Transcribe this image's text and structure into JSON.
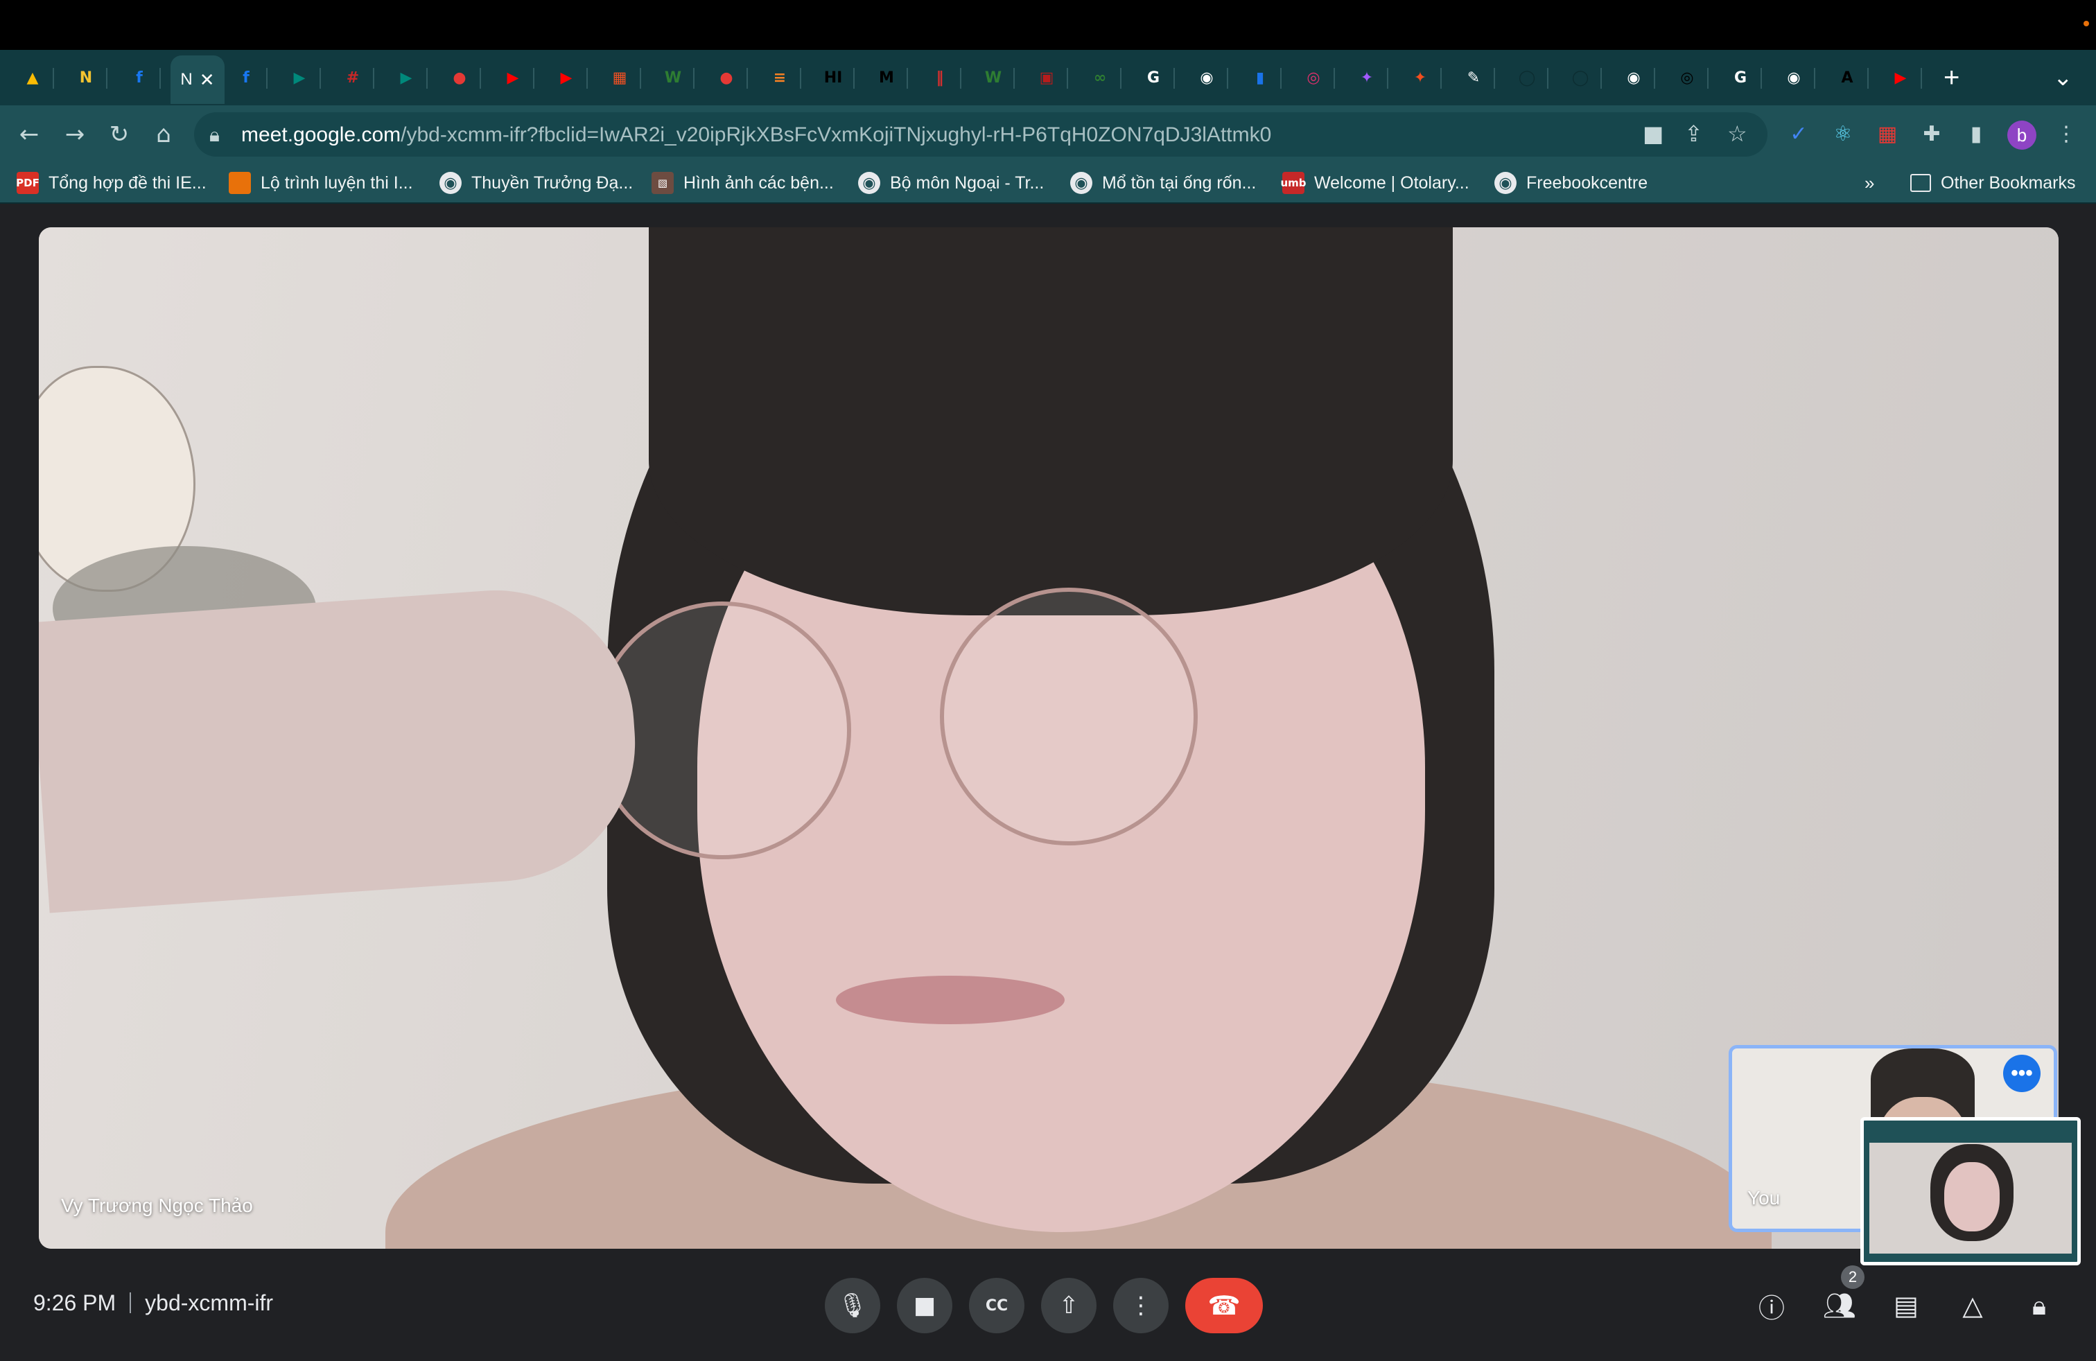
{
  "browser": {
    "active_tab_label": "N",
    "tab_favicons": [
      {
        "icon": "google-drive-icon",
        "glyph": "▲",
        "color": "#fbbc04"
      },
      {
        "icon": "notion-n-icon",
        "glyph": "N",
        "color": "#f4c430"
      },
      {
        "icon": "facebook-icon",
        "glyph": "f",
        "color": "#1877f2"
      },
      {
        "icon": "facebook-icon",
        "glyph": "f",
        "color": "#1877f2"
      },
      {
        "icon": "google-meet-icon",
        "glyph": "▶",
        "color": "#00897b"
      },
      {
        "icon": "grid-icon",
        "glyph": "#",
        "color": "#c62828"
      },
      {
        "icon": "google-meet-icon",
        "glyph": "▶",
        "color": "#00897b"
      },
      {
        "icon": "red-blob-icon",
        "glyph": "●",
        "color": "#e53935"
      },
      {
        "icon": "youtube-icon",
        "glyph": "▶",
        "color": "#ff0000"
      },
      {
        "icon": "youtube-icon",
        "glyph": "▶",
        "color": "#ff0000"
      },
      {
        "icon": "microsoft-icon",
        "glyph": "▦",
        "color": "#f25022"
      },
      {
        "icon": "w-icon",
        "glyph": "W",
        "color": "#2e7d32"
      },
      {
        "icon": "red-blob-icon",
        "glyph": "●",
        "color": "#e53935"
      },
      {
        "icon": "stack-icon",
        "glyph": "≡",
        "color": "#f48024"
      },
      {
        "icon": "hi-icon",
        "glyph": "HI",
        "color": "#000000"
      },
      {
        "icon": "m-icon",
        "glyph": "M",
        "color": "#000000"
      },
      {
        "icon": "red-book-icon",
        "glyph": "‖",
        "color": "#d32f2f"
      },
      {
        "icon": "w-icon",
        "glyph": "W",
        "color": "#2e7d32"
      },
      {
        "icon": "news-icon",
        "glyph": "▣",
        "color": "#b71c1c"
      },
      {
        "icon": "link-icon",
        "glyph": "∞",
        "color": "#2e7d32"
      },
      {
        "icon": "google-icon",
        "glyph": "G",
        "color": "#ffffff"
      },
      {
        "icon": "globe-icon",
        "glyph": "◉",
        "color": "#ffffff"
      },
      {
        "icon": "chart-icon",
        "glyph": "▮",
        "color": "#1a73e8"
      },
      {
        "icon": "instagram-icon",
        "glyph": "◎",
        "color": "#e1306c"
      },
      {
        "icon": "figma-icon",
        "glyph": "✦",
        "color": "#a259ff"
      },
      {
        "icon": "figma-icon",
        "glyph": "✦",
        "color": "#f24e1e"
      },
      {
        "icon": "pen-icon",
        "glyph": "✎",
        "color": "#ffffff"
      },
      {
        "icon": "github-icon",
        "glyph": "◯",
        "color": "#0c2d31"
      },
      {
        "icon": "github-icon",
        "glyph": "◯",
        "color": "#0c2d31"
      },
      {
        "icon": "globe-icon",
        "glyph": "◉",
        "color": "#ffffff"
      },
      {
        "icon": "circle-icon",
        "glyph": "◎",
        "color": "#000000"
      },
      {
        "icon": "google-icon",
        "glyph": "G",
        "color": "#ffffff"
      },
      {
        "icon": "globe-icon",
        "glyph": "◉",
        "color": "#ffffff"
      },
      {
        "icon": "a-icon",
        "glyph": "A",
        "color": "#000000"
      },
      {
        "icon": "youtube-icon",
        "glyph": "▶",
        "color": "#ff0000"
      }
    ],
    "new_tab_label": "+",
    "tab_menu_label": "⌄",
    "url_host": "meet.google.com",
    "url_path": "/ybd-xcmm-ifr?fbclid=IwAR2i_v20ipRjkXBsFcVxmKojiTNjxughyl-rH-P6TqH0ZON7qDJ3lAttmk0",
    "profile_initial": "b",
    "bookmarks": [
      {
        "label": "Tổng hợp đề thi IE...",
        "icon": "pdf-icon",
        "badge": "PDF",
        "color": "#d93025"
      },
      {
        "label": "Lộ trình luyện thi I...",
        "icon": "arrow-flag-icon",
        "badge": "",
        "color": "#e8710a"
      },
      {
        "label": "Thuyền Trưởng Đạ...",
        "icon": "globe-icon",
        "badge": "◉",
        "color": "#e8eaed"
      },
      {
        "label": "Hình ảnh các bện...",
        "icon": "image-icon",
        "badge": "▧",
        "color": "#6d4c41"
      },
      {
        "label": "Bộ môn Ngoại - Tr...",
        "icon": "globe-icon",
        "badge": "◉",
        "color": "#e8eaed"
      },
      {
        "label": "Mổ tồn tại ống rốn...",
        "icon": "globe-icon",
        "badge": "◉",
        "color": "#e8eaed"
      },
      {
        "label": "Welcome | Otolary...",
        "icon": "umb-icon",
        "badge": "umb",
        "color": "#c62828"
      },
      {
        "label": "Freebookcentre",
        "icon": "globe-icon",
        "badge": "◉",
        "color": "#e8eaed"
      }
    ],
    "bookmarks_overflow": "»",
    "other_bookmarks": "Other Bookmarks"
  },
  "meeting": {
    "main_participant": "Vy Trương Ngọc Thảo",
    "self_label": "You",
    "more_options_glyph": "•••",
    "time": "9:26 PM",
    "meeting_code": "ybd-xcmm-ifr",
    "participant_count": "2"
  },
  "colors": {
    "chrome_bg": "#1f5157",
    "meet_bg": "#202124",
    "hangup": "#ea4335",
    "accent": "#8ab4f8"
  }
}
